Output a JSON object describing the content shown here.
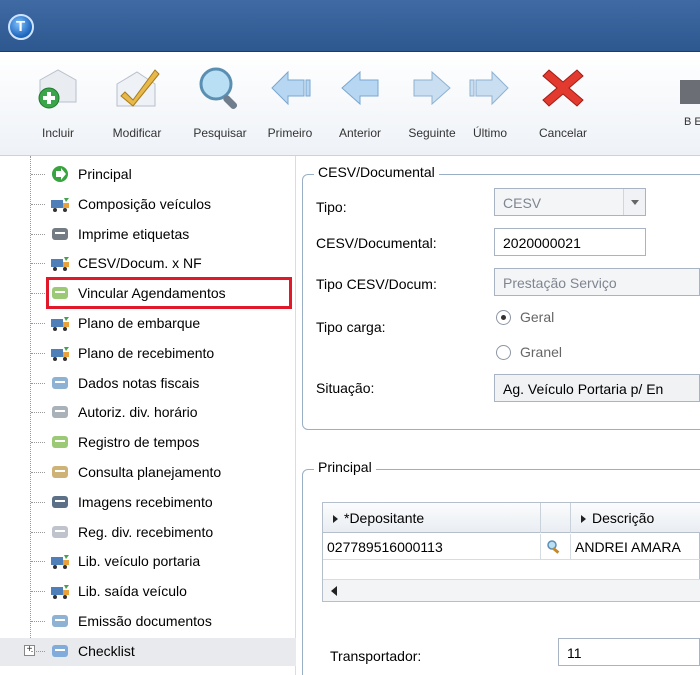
{
  "toolbar": {
    "buttons": [
      {
        "label": "Incluir",
        "icon": "add-document-icon"
      },
      {
        "label": "Modificar",
        "icon": "edit-pencil-icon"
      },
      {
        "label": "Pesquisar",
        "icon": "magnifier-icon"
      },
      {
        "label": "Primeiro",
        "icon": "first-arrow-icon"
      },
      {
        "label": "Anterior",
        "icon": "previous-arrow-icon"
      },
      {
        "label": "Seguinte",
        "icon": "next-arrow-icon"
      },
      {
        "label": "Último",
        "icon": "last-arrow-icon"
      },
      {
        "label": "Cancelar",
        "icon": "cancel-x-icon"
      },
      {
        "label": "B E",
        "icon": "truncated-icon"
      }
    ]
  },
  "tree": {
    "items": [
      {
        "label": "Principal",
        "icon": "green-arrow-icon"
      },
      {
        "label": "Composição veículos",
        "icon": "truck-icon"
      },
      {
        "label": "Imprime etiquetas",
        "icon": "printer-icon"
      },
      {
        "label": "CESV/Docum. x NF",
        "icon": "truck-icon"
      },
      {
        "label": "Vincular Agendamentos",
        "icon": "gear-link-icon"
      },
      {
        "label": "Plano de embarque",
        "icon": "truck-icon"
      },
      {
        "label": "Plano de recebimento",
        "icon": "truck-icon"
      },
      {
        "label": "Dados notas fiscais",
        "icon": "document-list-icon"
      },
      {
        "label": "Autoriz. div. horário",
        "icon": "clock-icon"
      },
      {
        "label": "Registro de tempos",
        "icon": "gear-link-icon"
      },
      {
        "label": "Consulta planejamento",
        "icon": "box-icon"
      },
      {
        "label": "Imagens recebimento",
        "icon": "camera-icon"
      },
      {
        "label": "Reg. div. recebimento",
        "icon": "flask-icon"
      },
      {
        "label": "Lib. veículo portaria",
        "icon": "truck-icon"
      },
      {
        "label": "Lib. saída veículo",
        "icon": "truck-icon"
      },
      {
        "label": "Emissão documentos",
        "icon": "document-list-icon"
      },
      {
        "label": "Checklist",
        "icon": "checklist-icon"
      }
    ]
  },
  "cesv": {
    "legend": "CESV/Documental",
    "tipo_label": "Tipo:",
    "tipo_value": "CESV",
    "doc_label": "CESV/Documental:",
    "doc_value": "2020000021",
    "tipo_doc_label": "Tipo CESV/Docum:",
    "tipo_doc_value": "Prestação Serviço",
    "carga_label": "Tipo carga:",
    "carga_opt1": "Geral",
    "carga_opt2": "Granel",
    "situacao_label": "Situação:",
    "situacao_value": "Ag. Veículo Portaria p/ En"
  },
  "principal": {
    "legend": "Principal",
    "columns": [
      "*Depositante",
      "Descrição"
    ],
    "row": {
      "depositante": "027789516000113",
      "descricao": "ANDREI AMARA"
    },
    "transportador_label": "Transportador:",
    "transportador_value": "11"
  }
}
